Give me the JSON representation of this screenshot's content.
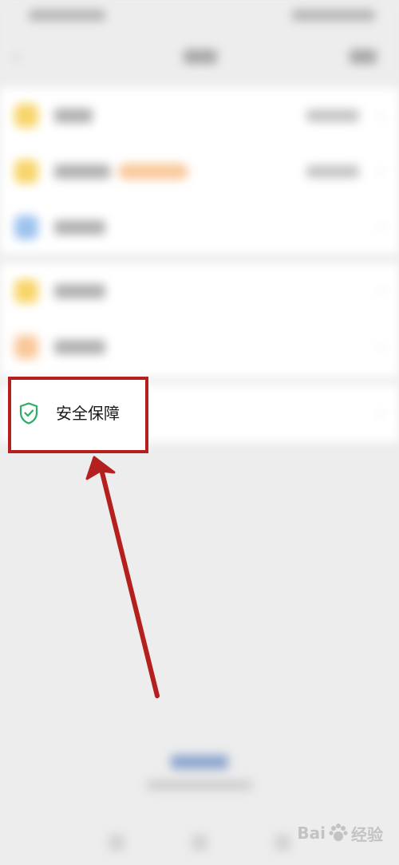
{
  "focus_item": {
    "label": "安全保障",
    "icon": "shield-check-icon",
    "icon_color": "#2bae67"
  },
  "annotation": {
    "box_color": "#b3201d",
    "arrow_color": "#b3201d"
  },
  "background_rows": [
    {
      "icon_color": "#f8d56a",
      "has_value": true
    },
    {
      "icon_color": "#f8d56a",
      "has_value": true,
      "badge_color": "#f9c89a"
    },
    {
      "icon_color": "#9dc2ee",
      "has_value": false
    },
    {
      "icon_color": "#f8d56a",
      "has_value": false
    },
    {
      "icon_color": "#f9c89a",
      "has_value": false
    }
  ],
  "watermark": {
    "brand_text": "Bai",
    "brand_suffix": "经验"
  }
}
